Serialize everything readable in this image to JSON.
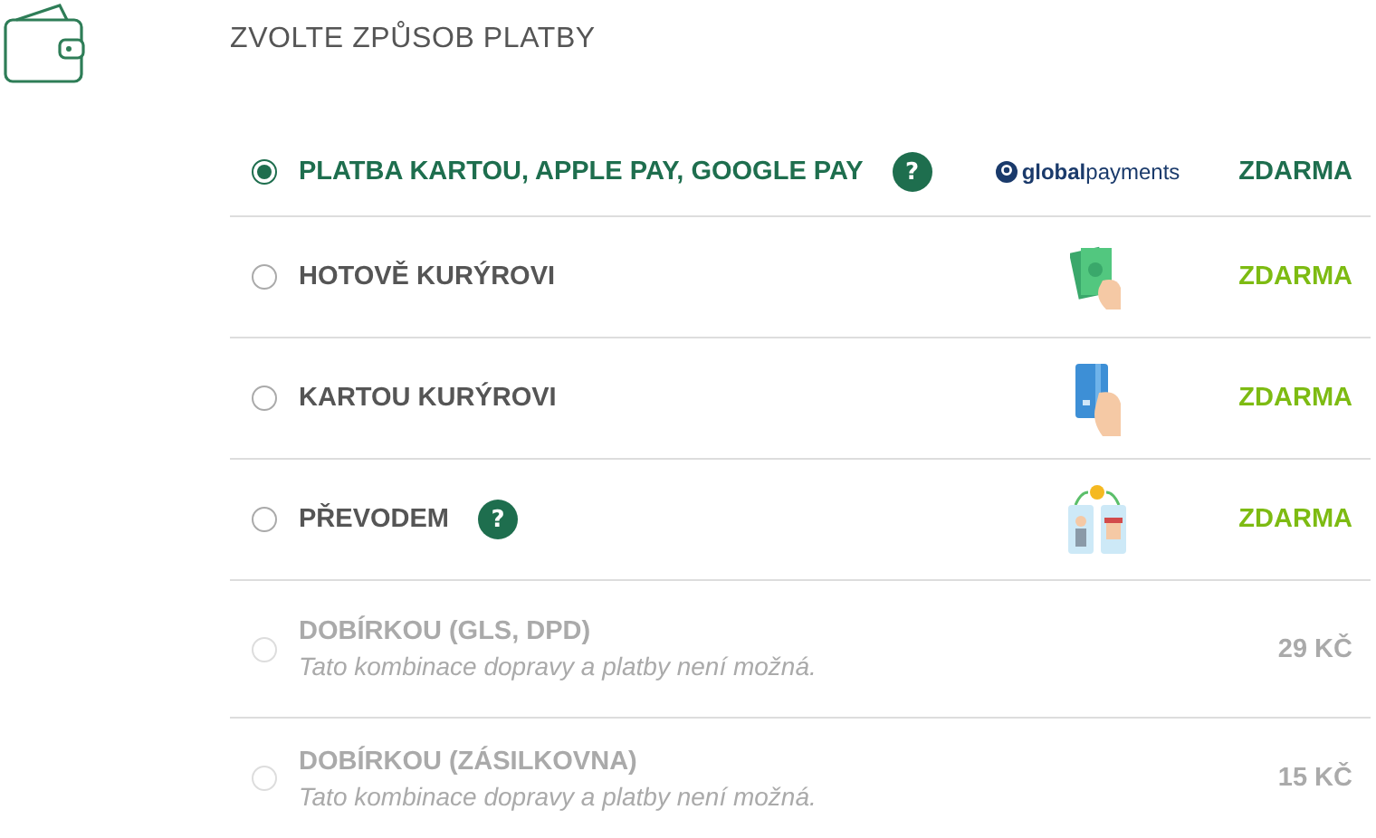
{
  "title": "ZVOLTE ZPŮSOB PLATBY",
  "options": [
    {
      "label": "PLATBA KARTOU, APPLE PAY, GOOGLE PAY",
      "selected": true,
      "disabled": false,
      "help": "?",
      "kind": "provider",
      "provider": "**global**payments",
      "price": "ZDARMA"
    },
    {
      "label": "HOTOVĚ KURÝROVI",
      "selected": false,
      "disabled": false,
      "kind": "cash",
      "price": "ZDARMA"
    },
    {
      "label": "KARTOU KURÝROVI",
      "selected": false,
      "disabled": false,
      "kind": "card",
      "price": "ZDARMA"
    },
    {
      "label": "PŘEVODEM",
      "selected": false,
      "disabled": false,
      "help": "?",
      "kind": "transfer",
      "price": "ZDARMA"
    },
    {
      "label": "DOBÍRKOU (GLS, DPD)",
      "selected": false,
      "disabled": true,
      "note": "Tato kombinace dopravy a platby není možná.",
      "price": "29 KČ"
    },
    {
      "label": "DOBÍRKOU (ZÁSILKOVNA)",
      "selected": false,
      "disabled": true,
      "note": "Tato kombinace dopravy a platby není možná.",
      "price": "15 KČ"
    }
  ]
}
